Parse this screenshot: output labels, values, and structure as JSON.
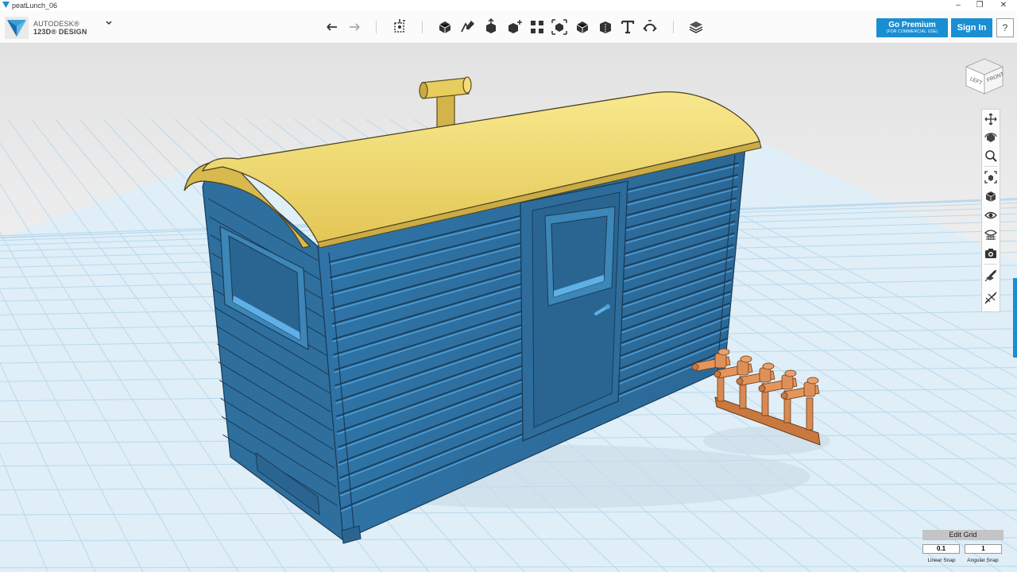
{
  "window": {
    "title": "peatLunch_06",
    "minimize": "–",
    "maximize": "❐",
    "close": "✕"
  },
  "brand": {
    "line1": "AUTODESK®",
    "line2": "123D® DESIGN"
  },
  "toolbar": {
    "tools": [
      "undo-icon",
      "redo-icon",
      "transform-icon",
      "primitives-icon",
      "sketch-icon",
      "construct-icon",
      "modify-icon",
      "pattern-icon",
      "grouping-icon",
      "combine-icon",
      "measure-icon",
      "text-tool-icon",
      "snap-icon",
      "material-icon"
    ]
  },
  "account": {
    "premium_label": "Go Premium",
    "premium_sub": "(FOR COMMERCIAL USE)",
    "signin_label": "Sign In",
    "help_label": "?"
  },
  "viewcube": {
    "left_face": "LEFT",
    "front_face": "FRONT"
  },
  "nav_panel": [
    "pan-icon",
    "orbit-icon",
    "zoom-icon",
    "fit-icon",
    "view-mode-icon",
    "visibility-icon",
    "material-view-icon",
    "screenshot-icon",
    "sketch-visibility-icon",
    "snap-visibility-icon"
  ],
  "grid_panel": {
    "edit_grid_label": "Edit Grid",
    "linear_snap_value": "0.1",
    "angular_snap_value": "1",
    "linear_snap_label": "Linear Snap",
    "angular_snap_label": "Angular Snap"
  },
  "colors": {
    "accent": "#1a8ed2",
    "body_blue": "#2f6f9f",
    "roof_yellow": "#ecd566",
    "parts_orange": "#d98a52",
    "grid_line": "#b8d8ea"
  }
}
